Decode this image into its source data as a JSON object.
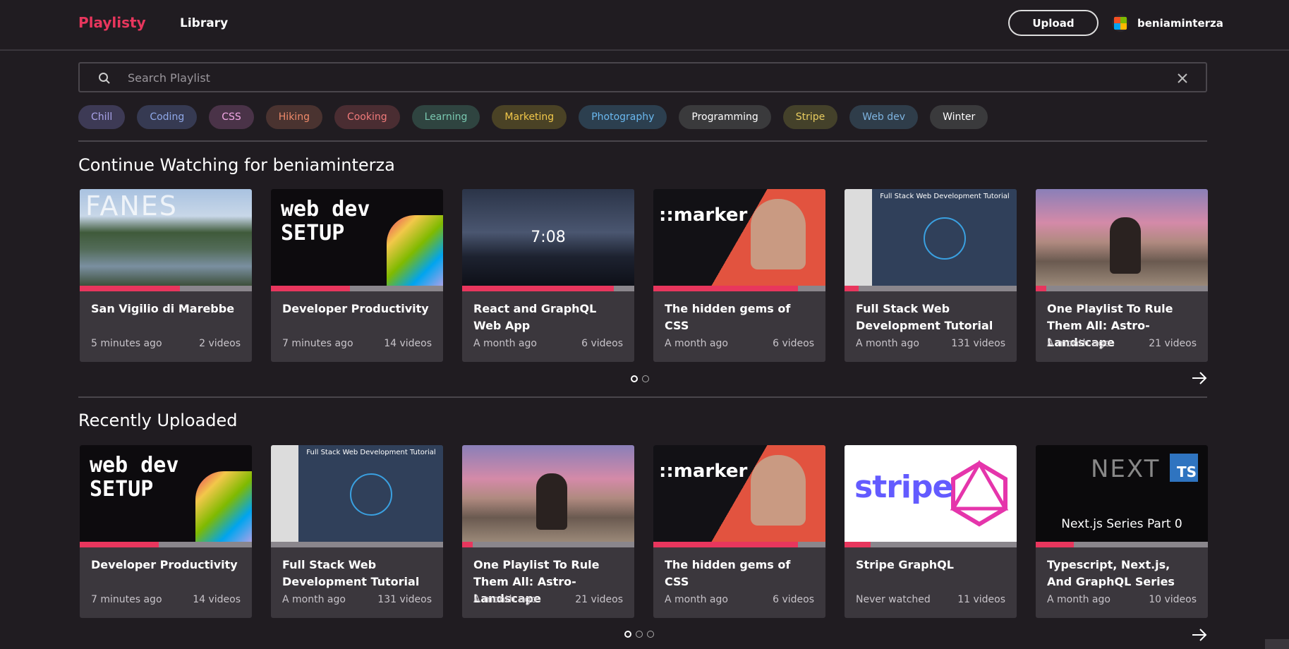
{
  "header": {
    "brand": "Playlisty",
    "nav_library": "Library",
    "upload_label": "Upload",
    "username": "beniaminterza"
  },
  "search": {
    "placeholder": "Search Playlist"
  },
  "tags": [
    {
      "label": "Chill",
      "bg": "#3d3a55",
      "fg": "#a8a2e8"
    },
    {
      "label": "Coding",
      "bg": "#363a52",
      "fg": "#8fa8e8"
    },
    {
      "label": "CSS",
      "bg": "#4a3348",
      "fg": "#f2a8e6"
    },
    {
      "label": "Hiking",
      "bg": "#4a3330",
      "fg": "#ef8a6a"
    },
    {
      "label": "Cooking",
      "bg": "#4a2d32",
      "fg": "#f07a7a"
    },
    {
      "label": "Learning",
      "bg": "#2f4440",
      "fg": "#79c8b0"
    },
    {
      "label": "Marketing",
      "bg": "#4a4225",
      "fg": "#f2c84a"
    },
    {
      "label": "Photography",
      "bg": "#2c3f4f",
      "fg": "#6ab8ef"
    },
    {
      "label": "Programming",
      "bg": "#3a3a3c",
      "fg": "#ffffff"
    },
    {
      "label": "Stripe",
      "bg": "#44412a",
      "fg": "#e8cc60"
    },
    {
      "label": "Web dev",
      "bg": "#2f3d4a",
      "fg": "#7eb4e0"
    },
    {
      "label": "Winter",
      "bg": "#3a3a3c",
      "fg": "#ffffff"
    }
  ],
  "continue_watching": {
    "title": "Continue Watching for beniaminterza",
    "cards": [
      {
        "title": "San Vigilio di Marebbe",
        "time": "5 minutes ago",
        "count": "2 videos",
        "progress": 0.58,
        "thumb_text": "FANES"
      },
      {
        "title": "Developer Productivity",
        "time": "7 minutes ago",
        "count": "14 videos",
        "progress": 0.46,
        "thumb_text": "web dev SETUP"
      },
      {
        "title": "React and GraphQL Web App",
        "time": "A month ago",
        "count": "6 videos",
        "progress": 0.88,
        "thumb_text": "7:08"
      },
      {
        "title": "The hidden gems of CSS",
        "time": "A month ago",
        "count": "6 videos",
        "progress": 0.84,
        "thumb_text": "::marker"
      },
      {
        "title": "Full Stack Web Development Tutorial",
        "time": "A month ago",
        "count": "131 videos",
        "progress": 0.08,
        "thumb_text": "Full Stack Web Development Tutorial"
      },
      {
        "title": "One Playlist To Rule Them All: Astro-Landscape",
        "time": "A month ago",
        "count": "21 videos",
        "progress": 0.06,
        "thumb_text": ""
      }
    ],
    "pages": 2,
    "active_page": 0
  },
  "recently_uploaded": {
    "title": "Recently Uploaded",
    "cards": [
      {
        "title": "Developer Productivity",
        "time": "7 minutes ago",
        "count": "14 videos",
        "progress": 0.46,
        "thumb_text": "web dev SETUP"
      },
      {
        "title": "Full Stack Web Development Tutorial",
        "time": "A month ago",
        "count": "131 videos",
        "progress": 0.0,
        "thumb_text": "Full Stack Web Development Tutorial"
      },
      {
        "title": "One Playlist To Rule Them All: Astro-Landscape",
        "time": "A month ago",
        "count": "21 videos",
        "progress": 0.06,
        "thumb_text": ""
      },
      {
        "title": "The hidden gems of CSS",
        "time": "A month ago",
        "count": "6 videos",
        "progress": 0.84,
        "thumb_text": "::marker"
      },
      {
        "title": "Stripe GraphQL",
        "time": "Never watched",
        "count": "11 videos",
        "progress": 0.15,
        "thumb_text": "stripe"
      },
      {
        "title": "Typescript, Next.js, And GraphQL Series",
        "time": "A month ago",
        "count": "10 videos",
        "progress": 0.22,
        "thumb_text": "Next.js Series Part 0"
      }
    ],
    "pages": 3,
    "active_page": 0
  },
  "icons": {
    "search": "search-icon",
    "clear": "close-icon",
    "next": "arrow-right-icon"
  }
}
